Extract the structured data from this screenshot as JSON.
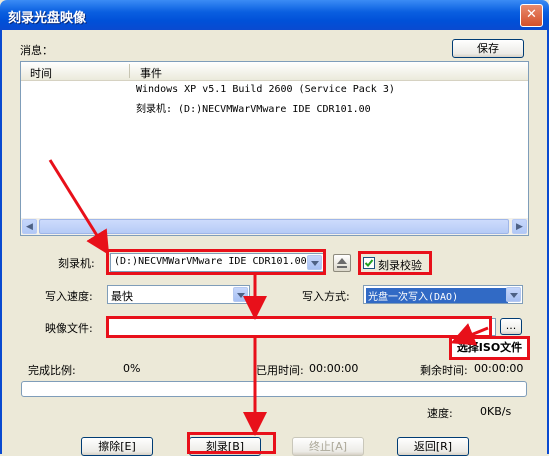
{
  "window": {
    "title": "刻录光盘映像",
    "close_glyph": "✕"
  },
  "messages": {
    "label": "消息：",
    "save_button": "保存",
    "columns": [
      "时间",
      "事件"
    ],
    "rows": [
      "Windows XP v5.1 Build 2600 (Service Pack 3)",
      "刻录机: (D:)NECVMWarVMware IDE CDR101.00"
    ]
  },
  "burner": {
    "label": "刻录机:",
    "value": "(D:)NECVMWarVMware IDE CDR101.00",
    "eject_icon": "eject-icon",
    "verify_label": "刻录校验",
    "verify_checked": true
  },
  "speed": {
    "label": "写入速度:",
    "value": "最快"
  },
  "mode": {
    "label": "写入方式:",
    "value": "光盘一次写入(DAO)"
  },
  "image_file": {
    "label": "映像文件:",
    "value": "",
    "browse_label": "..."
  },
  "callout": "选择ISO文件",
  "status": {
    "percent_label": "完成比例:",
    "percent_value": "0%",
    "elapsed_label": "已用时间:",
    "elapsed_value": "00:00:00",
    "remaining_label": "剩余时间:",
    "remaining_value": "00:00:00",
    "speed_label": "速度:",
    "speed_value": "0KB/s",
    "progress": 0
  },
  "buttons": {
    "erase": "擦除[E]",
    "burn": "刻录[B]",
    "stop": "终止[A]",
    "back": "返回[R]"
  },
  "colors": {
    "title_bar": "#0a5fe0",
    "annotation_red": "#e8101a",
    "dialog_bg": "#ece9d8",
    "selected": "#316ac5"
  }
}
